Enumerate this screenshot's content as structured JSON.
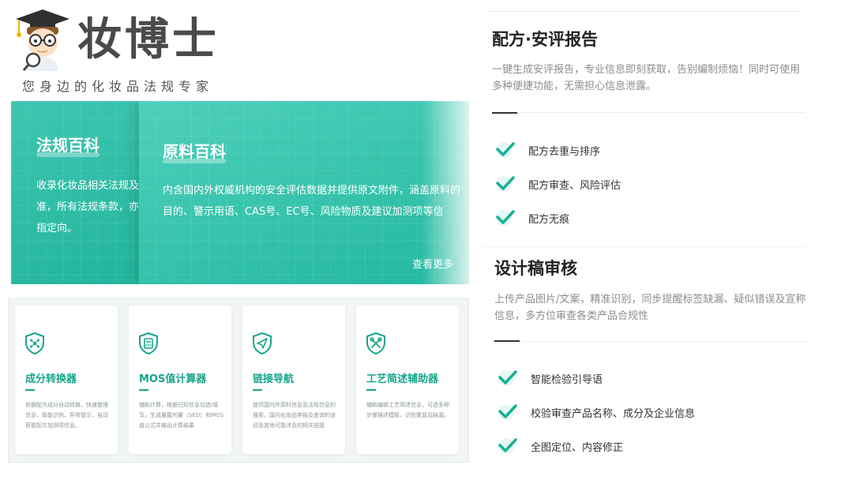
{
  "logo": {
    "brand": "妆博士",
    "slogan": "您身边的化妆品法规专家"
  },
  "cards": {
    "regulations": {
      "title": "法规百科",
      "text": "收录化妆品相关法规及标准，所有法规条款，亦可指定向。"
    },
    "ingredients": {
      "title": "原料百科",
      "text": "内含国内外权威机构的安全评估数据并提供原文附件，涵盖原料的目的、警示用语、CAS号、EC号、风险物质及建议加测项等信息。",
      "more": "查看更多"
    }
  },
  "tools": [
    {
      "name": "成分转换器",
      "icon": "shield-molecule-icon",
      "desc": "依据配方成分自动转换，快速整理信息，智能识别、异常提示，自动获取配方加测项信息。"
    },
    {
      "name": "MOS值计算器",
      "icon": "shield-calculator-icon",
      "desc": "辅助计算，根据已知信息勾选/填写，生成暴露剂量（SED）和MOS值公式并输出计算结果"
    },
    {
      "name": "链接导航",
      "icon": "shield-navigation-icon",
      "desc": "提供国内外原料信息及法规信息的搜索，国内化妆品申报及查询的途径及其他可能涉及的相关链接"
    },
    {
      "name": "工艺简述辅助器",
      "icon": "shield-tools-icon",
      "desc": "辅助编辑工艺简述信息，可选多种步骤描述模板，识别重复及缺漏。"
    }
  ],
  "formula_report": {
    "title": "配方·安评报告",
    "desc": "一键生成安评报告，专业信息即刻获取，告别编制烦恼！同时可使用多种便捷功能，无需担心信息泄露。",
    "features": [
      "配方去重与排序",
      "配方审查、风险评估",
      "配方无痕"
    ]
  },
  "design_review": {
    "title": "设计稿审核",
    "desc": "上传产品图片/文案，精准识别，同步提醒标签缺漏、疑似错误及宣称信息，多方位审查各类产品合规性",
    "features": [
      "智能检验引导语",
      "校验审查产品名称、成分及企业信息",
      "全图定位、内容修正"
    ]
  },
  "colors": {
    "teal": "#1fb39a",
    "accent": "#15a58c",
    "check": "#17b098"
  }
}
